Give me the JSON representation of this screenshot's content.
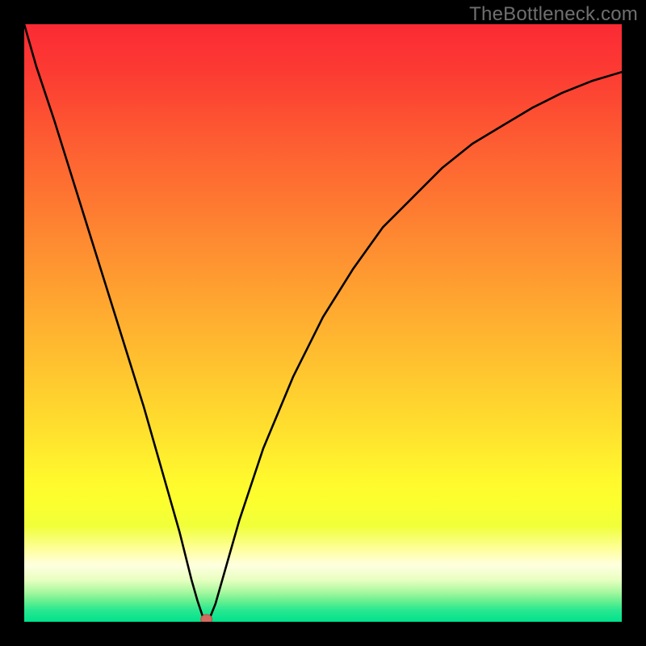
{
  "watermark": "TheBottleneck.com",
  "chart_data": {
    "type": "line",
    "title": "",
    "xlabel": "",
    "ylabel": "",
    "xlim": [
      0,
      100
    ],
    "ylim": [
      0,
      100
    ],
    "series": [
      {
        "name": "bottleneck-curve",
        "x": [
          0,
          2,
          5,
          10,
          15,
          20,
          22,
          24,
          26,
          27,
          28,
          29,
          30,
          30.5,
          31,
          32,
          34,
          36,
          40,
          45,
          50,
          55,
          60,
          65,
          70,
          75,
          80,
          85,
          90,
          95,
          100
        ],
        "values": [
          100,
          93,
          84,
          68,
          52,
          36,
          29,
          22,
          15,
          11,
          7,
          3.5,
          0.5,
          0,
          0.5,
          3,
          10,
          17,
          29,
          41,
          51,
          59,
          66,
          71,
          76,
          80,
          83,
          86,
          88.5,
          90.5,
          92
        ]
      }
    ],
    "marker": {
      "x": 30.5,
      "y": 0
    },
    "background_gradient": {
      "stops": [
        {
          "offset": 0.0,
          "color": "#fb2a34"
        },
        {
          "offset": 0.08,
          "color": "#fc3b33"
        },
        {
          "offset": 0.18,
          "color": "#fd5832"
        },
        {
          "offset": 0.28,
          "color": "#fe7331"
        },
        {
          "offset": 0.38,
          "color": "#fe8f31"
        },
        {
          "offset": 0.48,
          "color": "#ffaa30"
        },
        {
          "offset": 0.58,
          "color": "#ffc52f"
        },
        {
          "offset": 0.68,
          "color": "#ffe02e"
        },
        {
          "offset": 0.76,
          "color": "#fff82d"
        },
        {
          "offset": 0.8,
          "color": "#fcff2e"
        },
        {
          "offset": 0.84,
          "color": "#f0ff3a"
        },
        {
          "offset": 0.88,
          "color": "#ffffa0"
        },
        {
          "offset": 0.905,
          "color": "#ffffe0"
        },
        {
          "offset": 0.93,
          "color": "#e8ffc0"
        },
        {
          "offset": 0.95,
          "color": "#a8f8a0"
        },
        {
          "offset": 0.965,
          "color": "#6af090"
        },
        {
          "offset": 0.98,
          "color": "#2ae890"
        },
        {
          "offset": 1.0,
          "color": "#00e28c"
        }
      ]
    }
  }
}
